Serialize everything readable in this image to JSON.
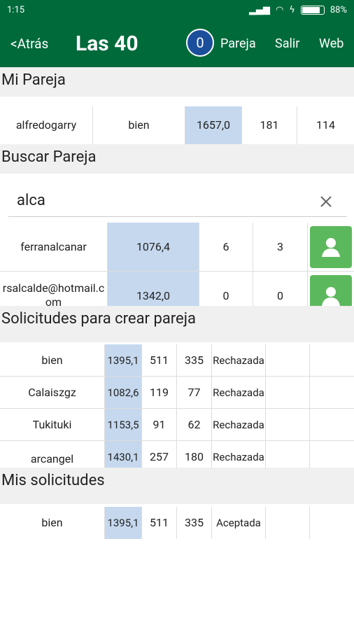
{
  "status": {
    "time": "1:15",
    "battery": "88%",
    "battery_level": 0.88
  },
  "appbar": {
    "back": "<Atrás",
    "title": "Las 40",
    "badge": "0",
    "pareja": "Pareja",
    "salir": "Salir",
    "web": "Web"
  },
  "mi_pareja": {
    "title": "Mi Pareja",
    "row": [
      "alfredogarry",
      "bien",
      "1657,0",
      "181",
      "114"
    ]
  },
  "buscar": {
    "title": "Buscar Pareja",
    "value": "alca",
    "results": [
      {
        "name": "ferranalcanar",
        "score": "1076,4",
        "a": "6",
        "b": "3"
      },
      {
        "name": "rsalcalde@hotmail.com",
        "score": "1342,0",
        "a": "0",
        "b": "0"
      }
    ]
  },
  "solicitudes": {
    "title": "Solicitudes para crear pareja",
    "rows": [
      {
        "name": "bien",
        "score": "1395,1",
        "a": "511",
        "b": "335",
        "status": "Rechazada"
      },
      {
        "name": "Calaiszgz",
        "score": "1082,6",
        "a": "119",
        "b": "77",
        "status": "Rechazada"
      },
      {
        "name": "Tukituki",
        "score": "1153,5",
        "a": "91",
        "b": "62",
        "status": "Rechazada"
      },
      {
        "name": "arcangel",
        "score": "1430,1",
        "a": "257",
        "b": "180",
        "status": "Rechazada"
      }
    ]
  },
  "mis_solicitudes": {
    "title": "Mis solicitudes",
    "rows": [
      {
        "name": "bien",
        "score": "1395,1",
        "a": "511",
        "b": "335",
        "status": "Aceptada"
      }
    ]
  }
}
